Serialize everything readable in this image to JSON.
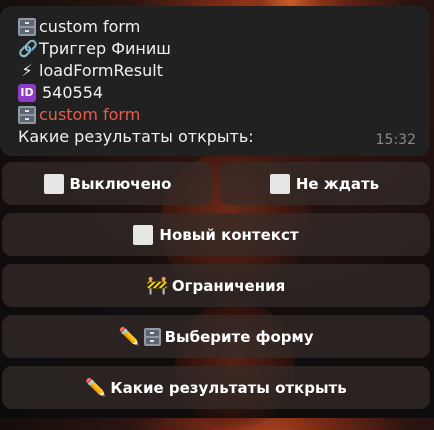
{
  "message": {
    "lines": [
      {
        "icon": "file-cabinet-icon",
        "text": "custom form"
      },
      {
        "icon": "link-icon",
        "glyph": "🔗",
        "text": "Триггер Финиш"
      },
      {
        "icon": "lightning-icon",
        "glyph": "⚡",
        "text": "loadFormResult"
      },
      {
        "icon": "id-badge-icon",
        "badge": "ID",
        "text": "540554"
      },
      {
        "icon": "file-cabinet-icon",
        "text": "custom form",
        "color": "#e85c4a"
      },
      {
        "text": "Какие результаты открыть:"
      }
    ],
    "time": "15:32"
  },
  "keyboard": {
    "rows": [
      [
        {
          "label": "Выключено",
          "icon": "checkbox-icon"
        },
        {
          "label": "Не ждать",
          "icon": "checkbox-icon"
        }
      ],
      [
        {
          "label": "Новый контекст",
          "icon": "checkbox-icon"
        }
      ],
      [
        {
          "label": "Ограничения",
          "icon": "construction-barrier-icon",
          "glyph": "🚧"
        }
      ],
      [
        {
          "label": "Выберите форму",
          "icon": "pencil-icon",
          "glyph": "✏️",
          "icon2": "file-cabinet-icon"
        }
      ],
      [
        {
          "label": "Какие результаты открыть",
          "icon": "pencil-icon",
          "glyph": "✏️"
        }
      ]
    ]
  },
  "colors": {
    "bubble_bg": "#212121",
    "accent_red": "#e85c4a",
    "id_badge": "#8e3bc8",
    "button_bg": "#342c2a"
  }
}
